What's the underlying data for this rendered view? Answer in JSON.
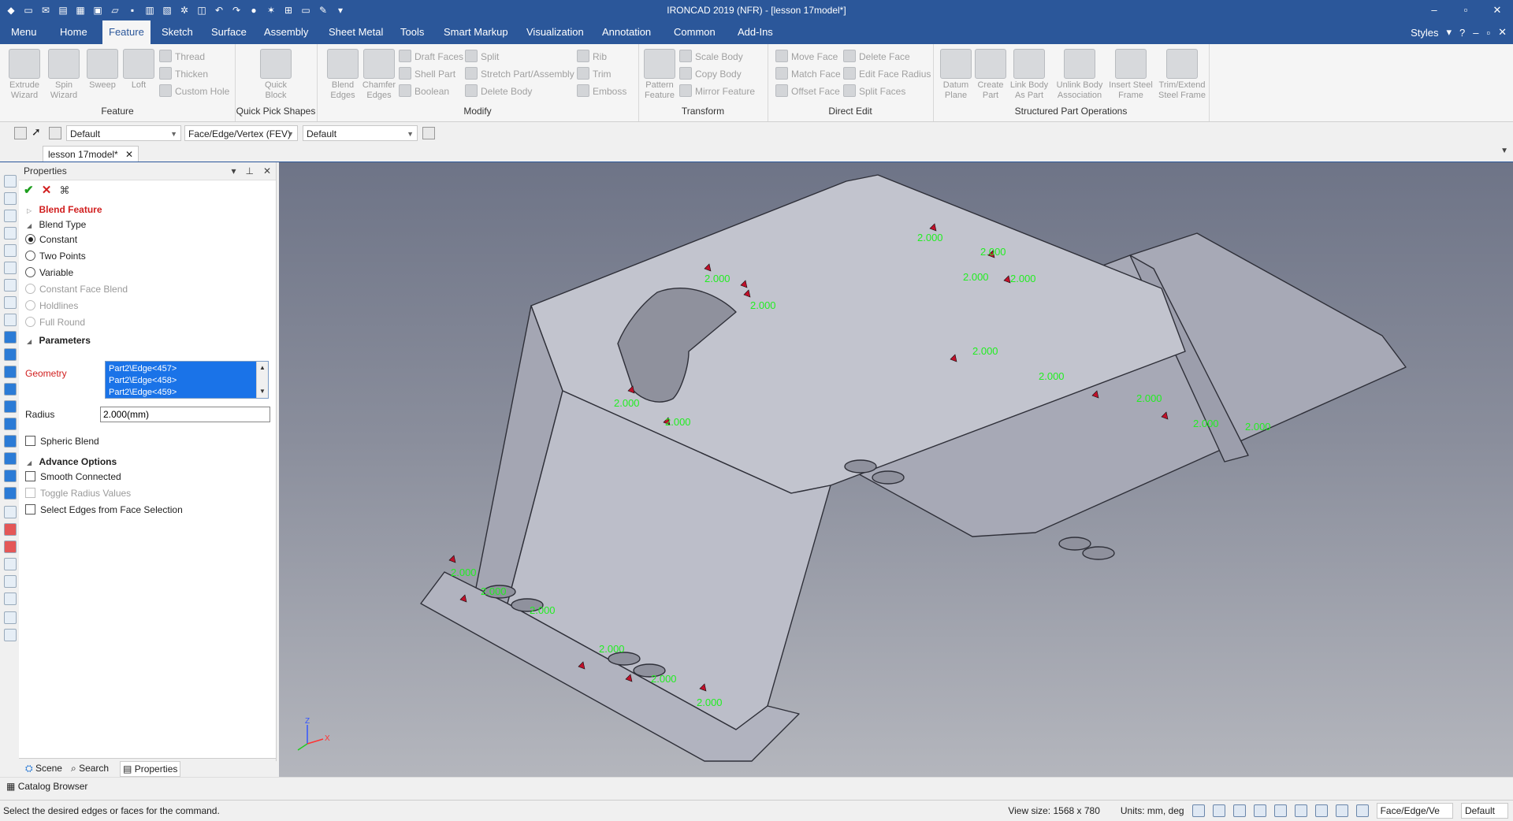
{
  "window": {
    "title": "IRONCAD 2019 (NFR) - [lesson 17model*]",
    "controls": [
      "–",
      "▫",
      "✕"
    ]
  },
  "menubar": {
    "tabs": [
      "Menu",
      "Home",
      "Feature",
      "Sketch",
      "Surface",
      "Assembly",
      "Sheet Metal",
      "Tools",
      "Smart Markup",
      "Visualization",
      "Annotation",
      "Common",
      "Add-Ins"
    ],
    "active": "Feature",
    "styles_label": "Styles"
  },
  "ribbon": {
    "feature": {
      "label": "Feature",
      "big": [
        "Extrude Wizard",
        "Spin Wizard",
        "Sweep",
        "Loft"
      ],
      "small": [
        "Thread",
        "Thicken",
        "Custom Hole"
      ]
    },
    "quick_pick": {
      "label": "Quick Pick Shapes",
      "big": [
        "Quick Block"
      ]
    },
    "modify": {
      "label": "Modify",
      "big": [
        "Blend Edges",
        "Chamfer Edges"
      ],
      "small": [
        "Draft Faces",
        "Shell Part",
        "Boolean",
        "Split",
        "Stretch Part/Assembly",
        "Delete Body",
        "Rib",
        "Trim",
        "Emboss"
      ]
    },
    "transform": {
      "label": "Transform",
      "big": [
        "Pattern Feature"
      ],
      "small": [
        "Scale Body",
        "Copy Body",
        "Mirror Feature"
      ]
    },
    "direct_edit": {
      "label": "Direct Edit",
      "small": [
        "Move Face",
        "Match Face",
        "Offset Face",
        "Delete Face",
        "Edit Face Radius",
        "Split Faces"
      ]
    },
    "structured": {
      "label": "Structured Part Operations",
      "big": [
        "Datum Plane",
        "Create Part",
        "Link Body As Part",
        "Unlink Body Association",
        "Insert Steel Frame",
        "Trim/Extend Steel Frame"
      ]
    }
  },
  "selection_bar": {
    "style": "Default",
    "filter": "Face/Edge/Vertex (FEV)",
    "scheme": "Default"
  },
  "document_tab": "lesson 17model*",
  "properties": {
    "header": "Properties",
    "feature_title": "Blend Feature",
    "blend_type_label": "Blend Type",
    "blend_types": [
      {
        "label": "Constant",
        "checked": true,
        "enabled": true
      },
      {
        "label": "Two Points",
        "checked": false,
        "enabled": true
      },
      {
        "label": "Variable",
        "checked": false,
        "enabled": true
      },
      {
        "label": "Constant Face Blend",
        "checked": false,
        "enabled": false
      },
      {
        "label": "Holdlines",
        "checked": false,
        "enabled": false
      },
      {
        "label": "Full Round",
        "checked": false,
        "enabled": false
      }
    ],
    "parameters_label": "Parameters",
    "geometry_label": "Geometry",
    "geometry_items": [
      "Part2\\Edge<457>",
      "Part2\\Edge<458>",
      "Part2\\Edge<459>"
    ],
    "radius_label": "Radius",
    "radius_value": "2.000(mm)",
    "spheric_blend": "Spheric Blend",
    "advance_options_label": "Advance Options",
    "advance_options": [
      {
        "label": "Smooth Connected",
        "enabled": true
      },
      {
        "label": "Toggle Radius Values",
        "enabled": false
      },
      {
        "label": "Select Edges from Face Selection",
        "enabled": true
      }
    ]
  },
  "bottom_tabs": [
    "Scene",
    "Search",
    "Properties"
  ],
  "bottom_active": "Properties",
  "catalog_browser": "Catalog Browser",
  "viewport": {
    "radius_labels": [
      "2.000",
      "2.000",
      "2.000",
      "2.000",
      "2.000",
      "2.000",
      "2.000",
      "2.000",
      "2.000",
      "2.000",
      "2.000",
      "2.000",
      "2.000",
      "2.000",
      "2.000",
      "2.000",
      "2.000",
      "2.000",
      "2.000"
    ],
    "triad": {
      "z": "Z",
      "x": "X"
    }
  },
  "status": {
    "message": "Select the desired edges or faces for the command.",
    "view_size": "View size: 1568 x  780",
    "units": "Units: mm, deg",
    "filter": "Face/Edge/Ve",
    "scheme": "Default"
  },
  "colors": {
    "accent": "#2b579a",
    "dim_green": "#22ee22",
    "arrow_red": "#c0102a",
    "feature_red": "#d11f1f"
  }
}
